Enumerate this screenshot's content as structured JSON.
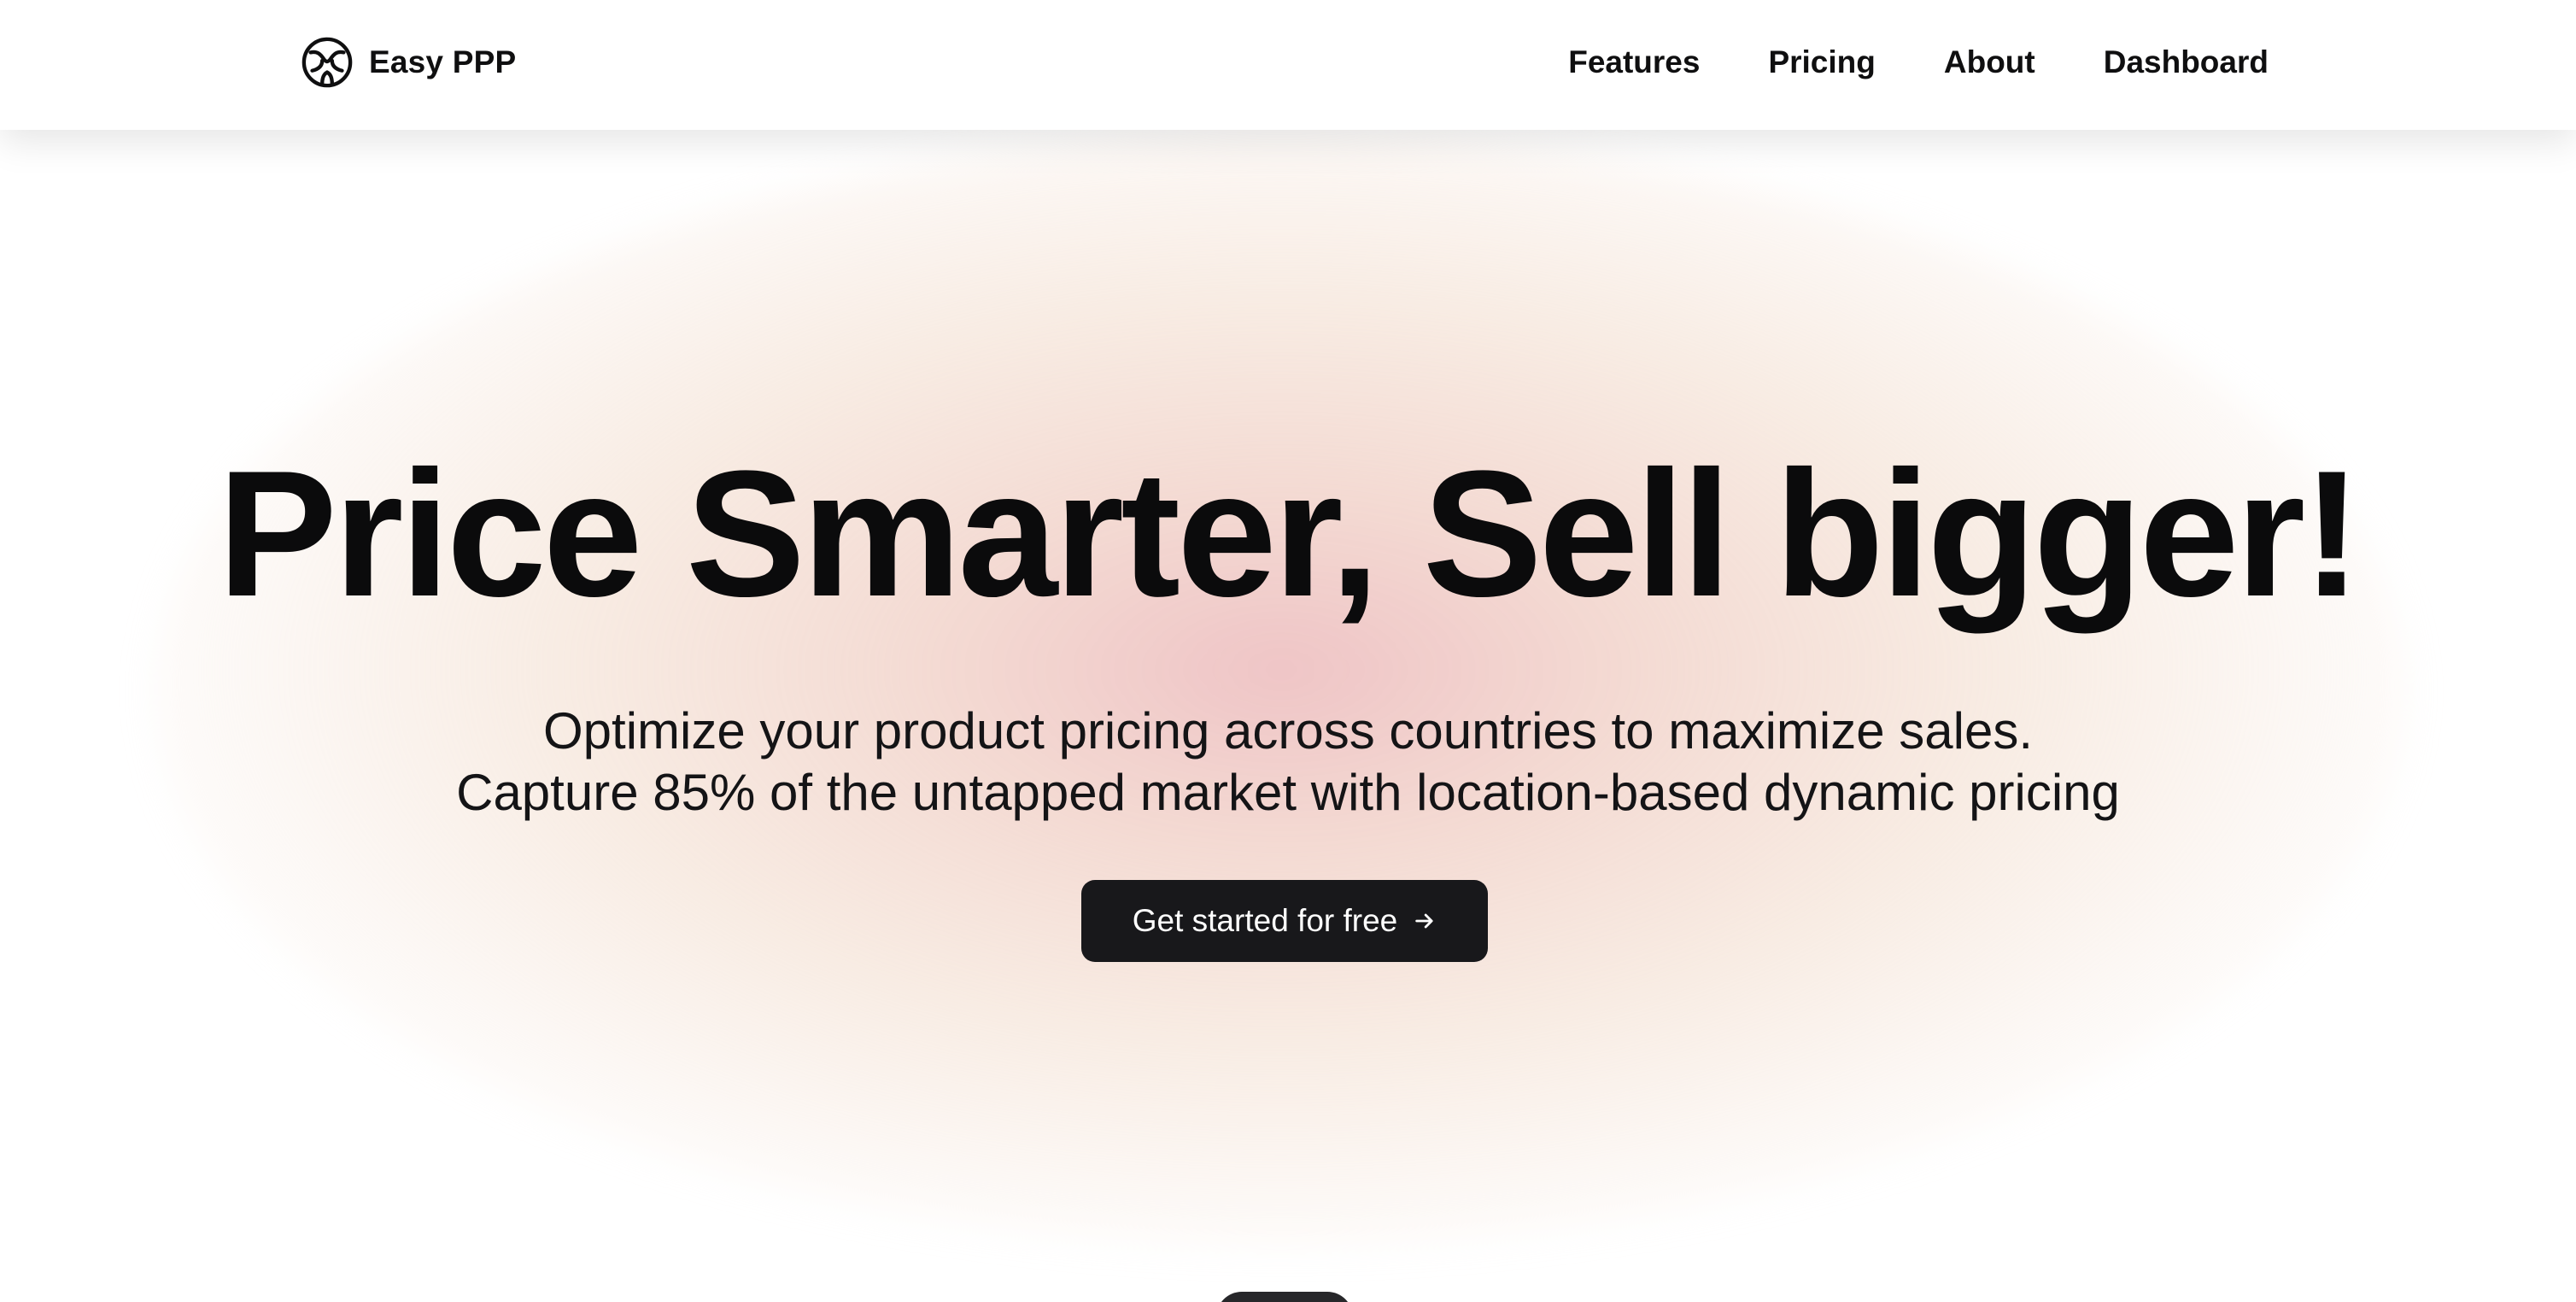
{
  "header": {
    "brand": {
      "name": "Easy PPP",
      "icon": "brand-logo-icon"
    },
    "nav": [
      {
        "label": "Features"
      },
      {
        "label": "Pricing"
      },
      {
        "label": "About"
      },
      {
        "label": "Dashboard"
      }
    ]
  },
  "hero": {
    "title": "Price Smarter, Sell bigger!",
    "subtitle_line1": "Optimize your product pricing across countries to maximize sales.",
    "subtitle_line2": "Capture 85% of the untapped market with location-based dynamic pricing",
    "cta_label": "Get started for free",
    "cta_icon": "arrow-right-icon"
  },
  "colors": {
    "text": "#0f0f10",
    "cta_background": "#18181b",
    "cta_text": "#ffffff",
    "glow_pink": "#ecbabc",
    "glow_peach": "#f2dccc"
  }
}
